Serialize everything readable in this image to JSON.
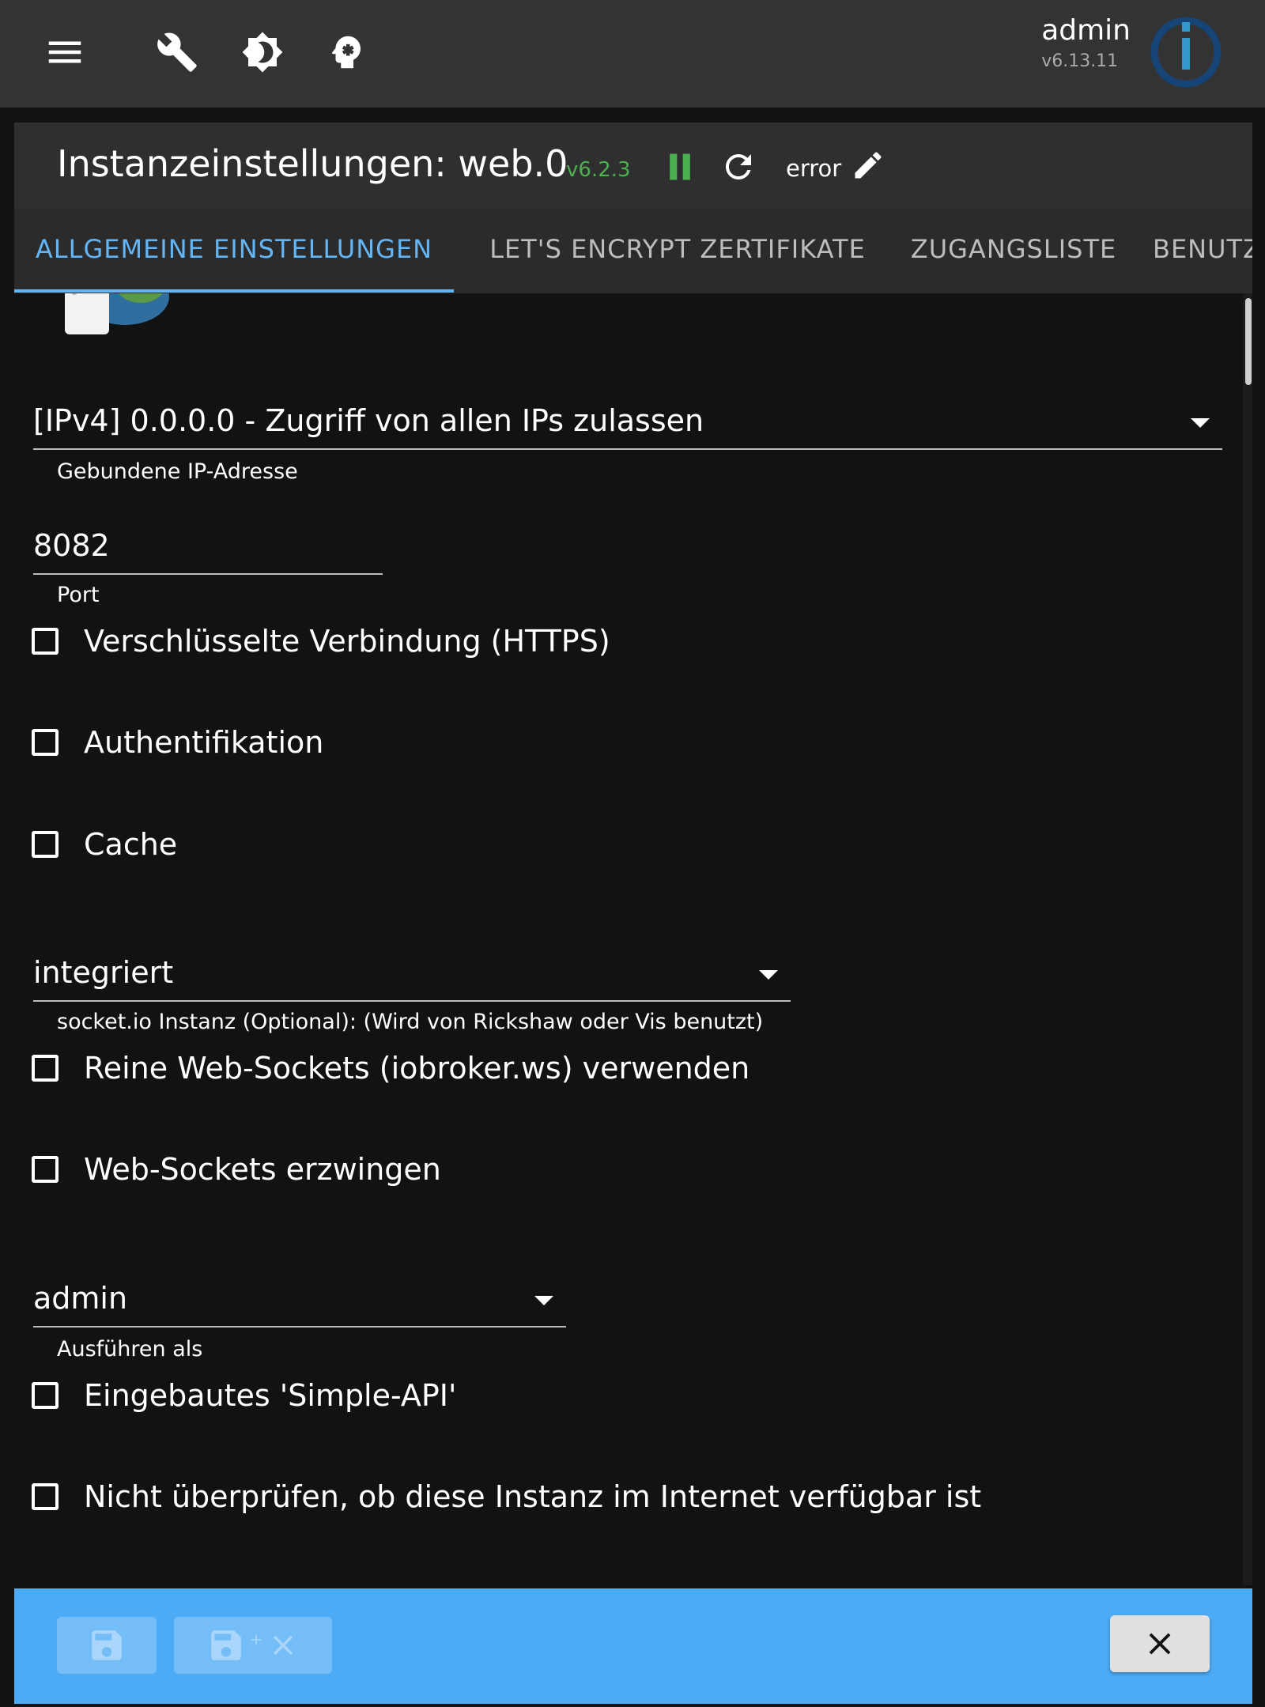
{
  "topbar": {
    "user_name": "admin",
    "user_version": "v6.13.11"
  },
  "header": {
    "title": "Instanzeinstellungen: web.0",
    "version": "v6.2.3",
    "log_level": "error"
  },
  "tabs": [
    {
      "label": "ALLGEMEINE EINSTELLUNGEN",
      "active": true
    },
    {
      "label": "LET'S ENCRYPT ZERTIFIKATE",
      "active": false
    },
    {
      "label": "ZUGANGSLISTE",
      "active": false
    },
    {
      "label": "BENUTZ",
      "active": false
    }
  ],
  "form": {
    "bind_select": {
      "value": "[IPv4] 0.0.0.0 - Zugriff von allen IPs zulassen",
      "helper": "Gebundene IP-Adresse"
    },
    "port": {
      "value": "8082",
      "helper": "Port"
    },
    "cb_https": {
      "label": "Verschlüsselte Verbindung (HTTPS)",
      "checked": false
    },
    "cb_auth": {
      "label": "Authentifikation",
      "checked": false
    },
    "cb_cache": {
      "label": "Cache",
      "checked": false
    },
    "socketio_select": {
      "value": "integriert",
      "helper": "socket.io Instanz (Optional): (Wird von Rickshaw oder Vis benutzt)"
    },
    "cb_pure_ws": {
      "label": "Reine Web-Sockets (iobroker.ws) verwenden",
      "checked": false
    },
    "cb_force_ws": {
      "label": "Web-Sockets erzwingen",
      "checked": false
    },
    "run_as_select": {
      "value": "admin",
      "helper": "Ausführen als"
    },
    "cb_simple_api": {
      "label": "Eingebautes 'Simple-API'",
      "checked": false
    },
    "cb_no_check": {
      "label": "Nicht überprüfen, ob diese Instanz im Internet verfügbar ist",
      "checked": false
    }
  },
  "colors": {
    "accent": "#64b5f6",
    "version_green": "#4caf50",
    "bottom_bar": "#4dabf5"
  }
}
